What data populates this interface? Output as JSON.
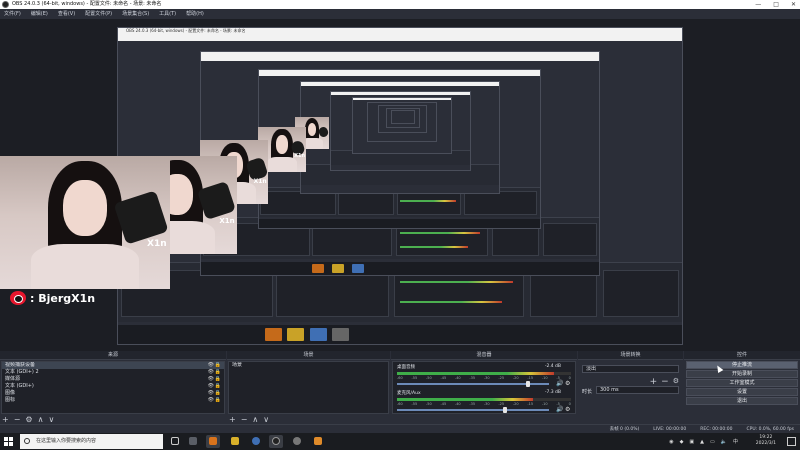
{
  "window": {
    "title": "OBS 24.0.3 (64-bit, windows) - 配置文件: 未命名 - 场景: 未命名",
    "controls": [
      "—",
      "□",
      "✕"
    ]
  },
  "menu": [
    "文件(F)",
    "编辑(E)",
    "查看(V)",
    "配置文件(P)",
    "场景集合(S)",
    "工具(T)",
    "帮助(H)"
  ],
  "overlay": {
    "handle": ": BjergX1n",
    "cam_tag": "X1n"
  },
  "docks": {
    "sources": {
      "title": "来源",
      "items": [
        "视频捕获设备",
        "文本 (GDI+) 2",
        "媒体源",
        "文本 (GDI+)",
        "图像",
        "图标"
      ],
      "footer": [
        "+",
        "−",
        "⚙",
        "∧",
        "∨"
      ]
    },
    "scenes": {
      "title": "场景",
      "items": [
        "场景"
      ],
      "footer": [
        "+",
        "−",
        "∧",
        "∨"
      ]
    },
    "mixer": {
      "title": "混音器",
      "channels": [
        {
          "name": "桌面音频",
          "db": "-2.4 dB",
          "level": 0.9,
          "volume": 0.86
        },
        {
          "name": "麦克风/Aux",
          "db": "-7.3 dB",
          "level": 0.78,
          "volume": 0.71
        }
      ],
      "scale": [
        "-60",
        "-55",
        "-50",
        "-45",
        "-40",
        "-35",
        "-30",
        "-25",
        "-20",
        "-15",
        "-10",
        "-5",
        "0"
      ]
    },
    "transitions": {
      "title": "场景转换",
      "selected": "淡出",
      "duration_label": "时长",
      "duration": "300 ms"
    },
    "controls": {
      "title": "控件",
      "buttons": [
        "停止推流",
        "开始录制",
        "工作室模式",
        "设置",
        "退出"
      ]
    }
  },
  "statusbar": {
    "live": "LIVE: 00:00:00",
    "rec": "REC: 00:00:00",
    "cpu": "CPU: 0.0%, 60.00 fps",
    "dropped": "丢帧 0 (0.0%)"
  },
  "taskbar": {
    "search_placeholder": "在这里输入你要搜索的内容",
    "time": "19:22",
    "date": "2022/3/1",
    "ime": "中"
  },
  "colors": {
    "obs_dark": "#2b2e38",
    "panel": "#1f2128",
    "meter_green": "#3fae49",
    "meter_yellow": "#d6c53a",
    "meter_red": "#c23a2b",
    "weibo_red": "#e6162d"
  }
}
